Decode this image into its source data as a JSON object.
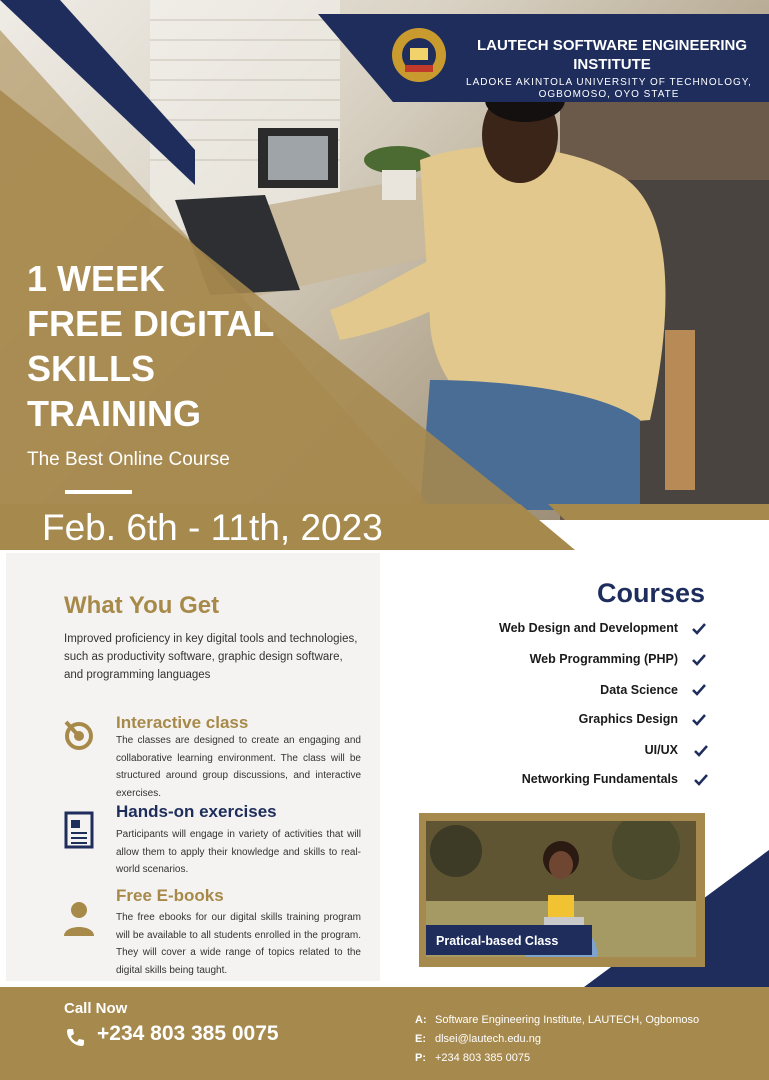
{
  "header": {
    "institute_title": "LAUTECH SOFTWARE ENGINEERING INSTITUTE",
    "institute_subtitle": "LADOKE AKINTOLA UNIVERSITY OF TECHNOLOGY, OGBOMOSO, OYO STATE",
    "logo_icon": "gear-seal-icon"
  },
  "hero": {
    "headline_lines": [
      "1 WEEK",
      "FREE DIGITAL",
      "SKILLS",
      "TRAINING"
    ],
    "tagline": "The Best Online Course",
    "date": "Feb. 6th - 11th, 2023"
  },
  "what_you_get": {
    "title": "What You Get",
    "intro": "Improved proficiency in key digital tools and technologies, such as productivity software, graphic design software, and programming languages",
    "features": [
      {
        "title": "Interactive class",
        "icon": "target-hand-icon",
        "color": "#a78a4a",
        "body": "The classes are designed to create an engaging and collaborative learning environment. The class will be structured around group discussions, and interactive exercises."
      },
      {
        "title": "Hands-on exercises",
        "icon": "document-icon",
        "color": "#1e2d5c",
        "body": "Participants will engage in variety of activities that will allow them to apply their knowledge and skills to real-world scenarios."
      },
      {
        "title": "Free E-books",
        "icon": "person-icon",
        "color": "#a78a4a",
        "body": "The free ebooks for our digital skills training program will be available to all students enrolled in the program. They will cover a wide range of topics related to the digital skills being taught."
      }
    ]
  },
  "courses": {
    "title": "Courses",
    "items": [
      "Web Design and Development",
      "Web Programming (PHP)",
      "Data Science",
      "Graphics Design",
      "UI/UX",
      "Networking Fundamentals"
    ],
    "check_icon": "checkmark-icon"
  },
  "photo_card": {
    "label": "Pratical-based Class"
  },
  "footer": {
    "call_label": "Call Now",
    "phone": "+234 803 385 0075",
    "contacts": [
      {
        "key": "A:",
        "value": "Software Engineering Institute, LAUTECH, Ogbomoso"
      },
      {
        "key": "E:",
        "value": "dlsei@lautech.edu.ng"
      },
      {
        "key": "P:",
        "value": "+234 803 385 0075"
      }
    ]
  },
  "colors": {
    "gold": "#a6894d",
    "navy": "#1e2d5c",
    "white": "#ffffff"
  }
}
